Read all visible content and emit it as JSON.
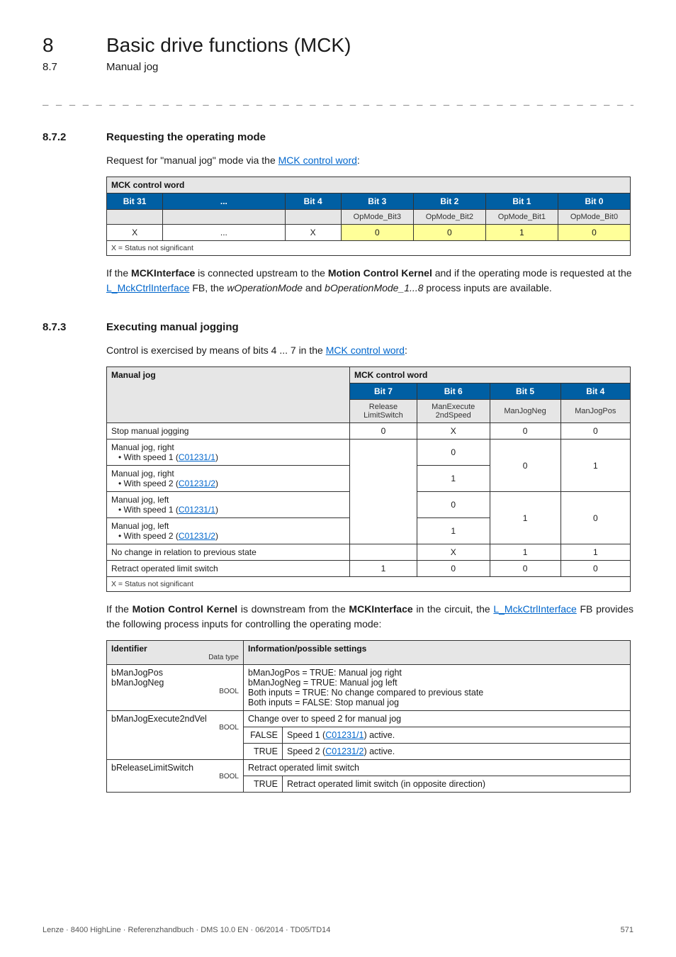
{
  "header": {
    "chapter_num": "8",
    "chapter_title": "Basic drive functions (MCK)",
    "section_num": "8.7",
    "section_title": "Manual jog",
    "dashes": "_ _ _ _ _ _ _ _ _ _ _ _ _ _ _ _ _ _ _ _ _ _ _ _ _ _ _ _ _ _ _ _ _ _ _ _ _ _ _ _ _ _ _ _ _ _ _ _ _ _ _ _ _ _ _ _ _ _ _ _ _ _ _ _"
  },
  "sec872": {
    "num": "8.7.2",
    "title": "Requesting the operating mode",
    "intro_pre": "Request for \"manual jog\" mode via the ",
    "intro_link": "MCK control word",
    "intro_post": ":",
    "table": {
      "caption": "MCK control word",
      "headers": [
        "Bit 31",
        "...",
        "Bit 4",
        "Bit 3",
        "Bit 2",
        "Bit 1",
        "Bit 0"
      ],
      "sub": [
        "",
        "",
        "",
        "OpMode_Bit3",
        "OpMode_Bit2",
        "OpMode_Bit1",
        "OpMode_Bit0"
      ],
      "vals": [
        "X",
        "...",
        "X",
        "0",
        "0",
        "1",
        "0"
      ],
      "foot": "X = Status not significant"
    },
    "para2_parts": {
      "p1": "If the ",
      "b1": "MCKInterface",
      "p2": " is connected upstream to the ",
      "b2": "Motion Control Kernel",
      "p3": " and if the operating mode is requested at the ",
      "link": "L_MckCtrlInterface",
      "p4": " FB, the ",
      "i1": "wOperationMode",
      "p5": " and ",
      "i2": "bOperationMode_1...8",
      "p6": " process inputs are available."
    }
  },
  "sec873": {
    "num": "8.7.3",
    "title": "Executing manual jogging",
    "intro_pre": "Control is exercised by means of bits 4 ... 7 in the ",
    "intro_link": "MCK control word",
    "intro_post": ":",
    "table1": {
      "head_left": "Manual jog",
      "head_right": "MCK control word",
      "bits": [
        "Bit 7",
        "Bit 6",
        "Bit 5",
        "Bit 4"
      ],
      "labels": [
        "Release\nLimitSwitch",
        "ManExecute\n2ndSpeed",
        "ManJogNeg",
        "ManJogPos"
      ],
      "rows": [
        {
          "label_plain": "Stop manual jogging",
          "v": [
            "0",
            "X",
            "0",
            "0"
          ]
        },
        {
          "label_pre": "Manual jog, right",
          "bullet_pre": "• With speed 1 (",
          "bullet_link": "C01231/1",
          "bullet_post": ")",
          "v": [
            "",
            "0",
            "0",
            "1"
          ]
        },
        {
          "label_pre": "Manual jog, right",
          "bullet_pre": "• With speed 2 (",
          "bullet_link": "C01231/2",
          "bullet_post": ")",
          "v": [
            "",
            "1",
            "",
            ""
          ]
        },
        {
          "label_pre": "Manual jog, left",
          "bullet_pre": "• With speed 1 (",
          "bullet_link": "C01231/1",
          "bullet_post": ")",
          "v": [
            "",
            "0",
            "1",
            "0"
          ]
        },
        {
          "label_pre": "Manual jog, left",
          "bullet_pre": "• With speed 2 (",
          "bullet_link": "C01231/2",
          "bullet_post": ")",
          "v": [
            "",
            "1",
            "",
            ""
          ]
        },
        {
          "label_plain": "No change in relation to previous state",
          "v": [
            "",
            "X",
            "1",
            "1"
          ]
        },
        {
          "label_plain": "Retract operated limit switch",
          "v": [
            "1",
            "0",
            "0",
            "0"
          ]
        }
      ],
      "foot": "X = Status not significant"
    },
    "para2_parts": {
      "p1": "If the ",
      "b1": "Motion Control Kernel",
      "p2": " is downstream from the ",
      "b2": "MCKInterface",
      "p3": " in the circuit, the ",
      "link": "L_MckCtrlInterface",
      "p4": " FB provides the following process inputs for controlling the operating mode:"
    },
    "table2": {
      "h1": "Identifier",
      "h1_sub": "Data type",
      "h2": "Information/possible settings",
      "rows": [
        {
          "id1": "bManJogPos",
          "id2": "bManJogNeg",
          "dtype": "BOOL",
          "lines": [
            "bManJogPos = TRUE: Manual jog right",
            "bManJogNeg = TRUE: Manual jog left",
            "Both inputs = TRUE: No change compared to previous state",
            "Both inputs = FALSE: Stop manual jog"
          ]
        },
        {
          "id1": "bManJogExecute2ndVel",
          "dtype": "BOOL",
          "main": "Change over to speed 2 for manual jog",
          "sub": [
            {
              "k": "FALSE",
              "pre": "Speed 1 (",
              "link": "C01231/1",
              "post": ") active."
            },
            {
              "k": "TRUE",
              "pre": "Speed 2 (",
              "link": "C01231/2",
              "post": ") active."
            }
          ]
        },
        {
          "id1": "bReleaseLimitSwitch",
          "dtype": "BOOL",
          "main": "Retract operated limit switch",
          "sub": [
            {
              "k": "TRUE",
              "plain": "Retract operated limit switch (in opposite direction)"
            }
          ]
        }
      ]
    }
  },
  "footer": {
    "left": "Lenze · 8400 HighLine · Referenzhandbuch · DMS 10.0 EN · 06/2014 · TD05/TD14",
    "right": "571"
  }
}
